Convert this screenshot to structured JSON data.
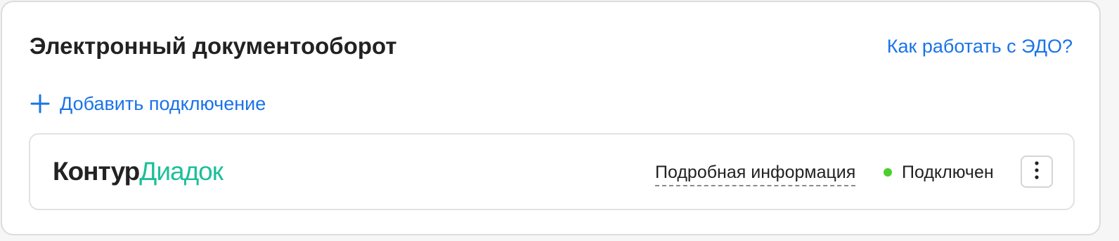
{
  "header": {
    "title": "Электронный документооборот",
    "help_link": "Как работать с ЭДО?"
  },
  "actions": {
    "add_connection_label": "Добавить подключение",
    "add_icon": "plus-icon"
  },
  "services": [
    {
      "logo_part1": "Контур",
      "logo_part2": "Диадок",
      "details_label": "Подробная информация",
      "status_label": "Подключен",
      "status_color": "#4ccf2c",
      "menu_icon": "more-vertical-icon"
    }
  ],
  "colors": {
    "link": "#1a73e8",
    "logo_brand": "#1dbf9a",
    "text": "#222222"
  }
}
